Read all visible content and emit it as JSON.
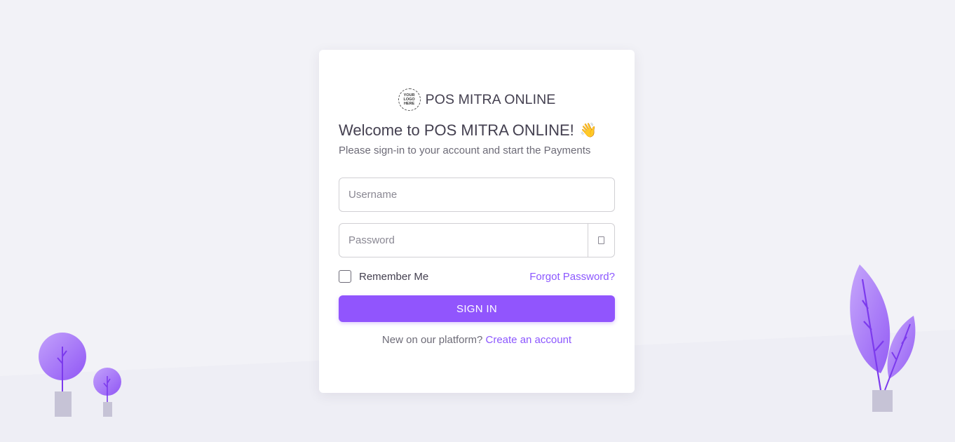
{
  "brand": {
    "logo_text": "YOUR\nLOGO\nHERE",
    "name": "POS MITRA ONLINE"
  },
  "welcome": {
    "title": "Welcome to POS MITRA ONLINE!",
    "emoji": "👋",
    "subtitle": "Please sign-in to your account and start the Payments"
  },
  "form": {
    "username_placeholder": "Username",
    "password_placeholder": "Password",
    "password_toggle_icon": "eye-icon",
    "remember_label": "Remember Me",
    "remember_checked": false,
    "forgot_label": "Forgot Password?",
    "submit_label": "SIGN IN"
  },
  "footer": {
    "prompt": "New on our platform?",
    "link": "Create an account"
  },
  "colors": {
    "primary": "#9155fd",
    "link": "#8c57ff",
    "background": "#f2f2f7",
    "plant": "#9d6bf5",
    "pot": "#c6c3d6"
  }
}
